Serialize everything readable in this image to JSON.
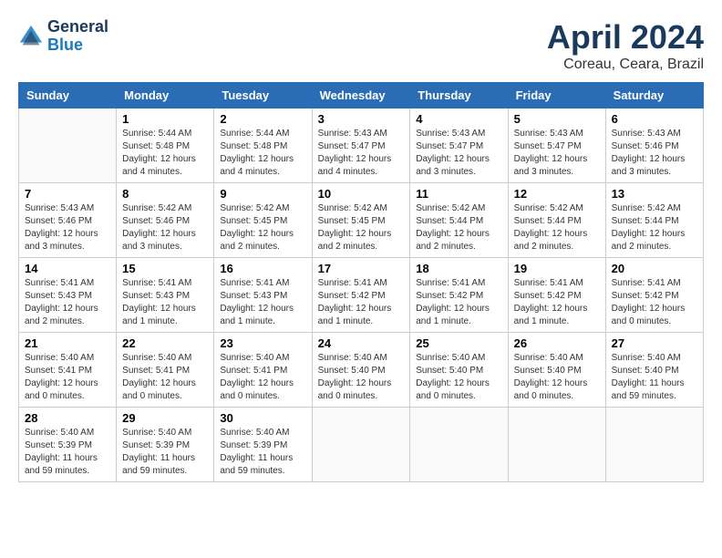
{
  "header": {
    "logo_line1": "General",
    "logo_line2": "Blue",
    "title": "April 2024",
    "location": "Coreau, Ceara, Brazil"
  },
  "days_of_week": [
    "Sunday",
    "Monday",
    "Tuesday",
    "Wednesday",
    "Thursday",
    "Friday",
    "Saturday"
  ],
  "weeks": [
    [
      {
        "num": "",
        "sunrise": "",
        "sunset": "",
        "daylight": ""
      },
      {
        "num": "1",
        "sunrise": "Sunrise: 5:44 AM",
        "sunset": "Sunset: 5:48 PM",
        "daylight": "Daylight: 12 hours and 4 minutes."
      },
      {
        "num": "2",
        "sunrise": "Sunrise: 5:44 AM",
        "sunset": "Sunset: 5:48 PM",
        "daylight": "Daylight: 12 hours and 4 minutes."
      },
      {
        "num": "3",
        "sunrise": "Sunrise: 5:43 AM",
        "sunset": "Sunset: 5:47 PM",
        "daylight": "Daylight: 12 hours and 4 minutes."
      },
      {
        "num": "4",
        "sunrise": "Sunrise: 5:43 AM",
        "sunset": "Sunset: 5:47 PM",
        "daylight": "Daylight: 12 hours and 3 minutes."
      },
      {
        "num": "5",
        "sunrise": "Sunrise: 5:43 AM",
        "sunset": "Sunset: 5:47 PM",
        "daylight": "Daylight: 12 hours and 3 minutes."
      },
      {
        "num": "6",
        "sunrise": "Sunrise: 5:43 AM",
        "sunset": "Sunset: 5:46 PM",
        "daylight": "Daylight: 12 hours and 3 minutes."
      }
    ],
    [
      {
        "num": "7",
        "sunrise": "Sunrise: 5:43 AM",
        "sunset": "Sunset: 5:46 PM",
        "daylight": "Daylight: 12 hours and 3 minutes."
      },
      {
        "num": "8",
        "sunrise": "Sunrise: 5:42 AM",
        "sunset": "Sunset: 5:46 PM",
        "daylight": "Daylight: 12 hours and 3 minutes."
      },
      {
        "num": "9",
        "sunrise": "Sunrise: 5:42 AM",
        "sunset": "Sunset: 5:45 PM",
        "daylight": "Daylight: 12 hours and 2 minutes."
      },
      {
        "num": "10",
        "sunrise": "Sunrise: 5:42 AM",
        "sunset": "Sunset: 5:45 PM",
        "daylight": "Daylight: 12 hours and 2 minutes."
      },
      {
        "num": "11",
        "sunrise": "Sunrise: 5:42 AM",
        "sunset": "Sunset: 5:44 PM",
        "daylight": "Daylight: 12 hours and 2 minutes."
      },
      {
        "num": "12",
        "sunrise": "Sunrise: 5:42 AM",
        "sunset": "Sunset: 5:44 PM",
        "daylight": "Daylight: 12 hours and 2 minutes."
      },
      {
        "num": "13",
        "sunrise": "Sunrise: 5:42 AM",
        "sunset": "Sunset: 5:44 PM",
        "daylight": "Daylight: 12 hours and 2 minutes."
      }
    ],
    [
      {
        "num": "14",
        "sunrise": "Sunrise: 5:41 AM",
        "sunset": "Sunset: 5:43 PM",
        "daylight": "Daylight: 12 hours and 2 minutes."
      },
      {
        "num": "15",
        "sunrise": "Sunrise: 5:41 AM",
        "sunset": "Sunset: 5:43 PM",
        "daylight": "Daylight: 12 hours and 1 minute."
      },
      {
        "num": "16",
        "sunrise": "Sunrise: 5:41 AM",
        "sunset": "Sunset: 5:43 PM",
        "daylight": "Daylight: 12 hours and 1 minute."
      },
      {
        "num": "17",
        "sunrise": "Sunrise: 5:41 AM",
        "sunset": "Sunset: 5:42 PM",
        "daylight": "Daylight: 12 hours and 1 minute."
      },
      {
        "num": "18",
        "sunrise": "Sunrise: 5:41 AM",
        "sunset": "Sunset: 5:42 PM",
        "daylight": "Daylight: 12 hours and 1 minute."
      },
      {
        "num": "19",
        "sunrise": "Sunrise: 5:41 AM",
        "sunset": "Sunset: 5:42 PM",
        "daylight": "Daylight: 12 hours and 1 minute."
      },
      {
        "num": "20",
        "sunrise": "Sunrise: 5:41 AM",
        "sunset": "Sunset: 5:42 PM",
        "daylight": "Daylight: 12 hours and 0 minutes."
      }
    ],
    [
      {
        "num": "21",
        "sunrise": "Sunrise: 5:40 AM",
        "sunset": "Sunset: 5:41 PM",
        "daylight": "Daylight: 12 hours and 0 minutes."
      },
      {
        "num": "22",
        "sunrise": "Sunrise: 5:40 AM",
        "sunset": "Sunset: 5:41 PM",
        "daylight": "Daylight: 12 hours and 0 minutes."
      },
      {
        "num": "23",
        "sunrise": "Sunrise: 5:40 AM",
        "sunset": "Sunset: 5:41 PM",
        "daylight": "Daylight: 12 hours and 0 minutes."
      },
      {
        "num": "24",
        "sunrise": "Sunrise: 5:40 AM",
        "sunset": "Sunset: 5:40 PM",
        "daylight": "Daylight: 12 hours and 0 minutes."
      },
      {
        "num": "25",
        "sunrise": "Sunrise: 5:40 AM",
        "sunset": "Sunset: 5:40 PM",
        "daylight": "Daylight: 12 hours and 0 minutes."
      },
      {
        "num": "26",
        "sunrise": "Sunrise: 5:40 AM",
        "sunset": "Sunset: 5:40 PM",
        "daylight": "Daylight: 12 hours and 0 minutes."
      },
      {
        "num": "27",
        "sunrise": "Sunrise: 5:40 AM",
        "sunset": "Sunset: 5:40 PM",
        "daylight": "Daylight: 11 hours and 59 minutes."
      }
    ],
    [
      {
        "num": "28",
        "sunrise": "Sunrise: 5:40 AM",
        "sunset": "Sunset: 5:39 PM",
        "daylight": "Daylight: 11 hours and 59 minutes."
      },
      {
        "num": "29",
        "sunrise": "Sunrise: 5:40 AM",
        "sunset": "Sunset: 5:39 PM",
        "daylight": "Daylight: 11 hours and 59 minutes."
      },
      {
        "num": "30",
        "sunrise": "Sunrise: 5:40 AM",
        "sunset": "Sunset: 5:39 PM",
        "daylight": "Daylight: 11 hours and 59 minutes."
      },
      {
        "num": "",
        "sunrise": "",
        "sunset": "",
        "daylight": ""
      },
      {
        "num": "",
        "sunrise": "",
        "sunset": "",
        "daylight": ""
      },
      {
        "num": "",
        "sunrise": "",
        "sunset": "",
        "daylight": ""
      },
      {
        "num": "",
        "sunrise": "",
        "sunset": "",
        "daylight": ""
      }
    ]
  ]
}
